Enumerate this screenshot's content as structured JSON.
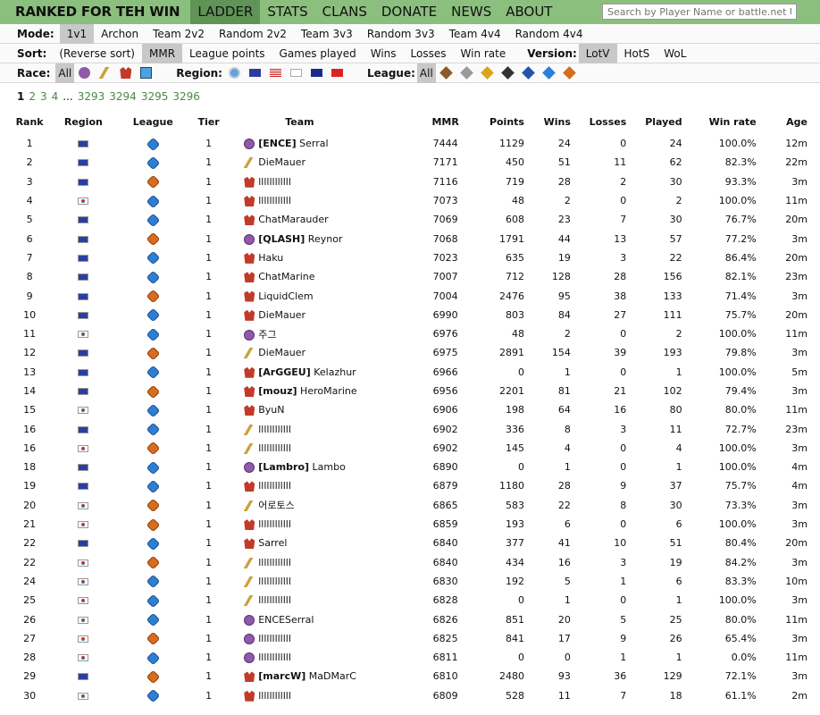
{
  "nav": {
    "brand": "RANKED FOR TEH WIN",
    "links": [
      "LADDER",
      "STATS",
      "CLANS",
      "DONATE",
      "NEWS",
      "ABOUT"
    ],
    "active": "LADDER",
    "search_placeholder": "Search by Player Name or battle.net URL"
  },
  "mode": {
    "label": "Mode:",
    "options": [
      "1v1",
      "Archon",
      "Team 2v2",
      "Random 2v2",
      "Team 3v3",
      "Random 3v3",
      "Team 4v4",
      "Random 4v4"
    ],
    "selected": "1v1"
  },
  "sort": {
    "label": "Sort:",
    "options": [
      "(Reverse sort)",
      "MMR",
      "League points",
      "Games played",
      "Wins",
      "Losses",
      "Win rate"
    ],
    "selected": "MMR",
    "version_label": "Version:",
    "versions": [
      "LotV",
      "HotS",
      "WoL"
    ],
    "version_selected": "LotV"
  },
  "race_filter": {
    "label": "Race:",
    "all": "All",
    "icons": [
      "zerg-icon",
      "protoss-icon",
      "terran-icon",
      "random-icon"
    ]
  },
  "region_filter": {
    "label": "Region:",
    "icons": [
      "globe-icon",
      "eu-flag-icon",
      "us-flag-icon",
      "kr-flag-icon",
      "au-flag-icon",
      "cn-flag-icon"
    ]
  },
  "league_filter": {
    "label": "League:",
    "all": "All",
    "icons": [
      "bronze-icon",
      "silver-icon",
      "gold-icon",
      "platinum-icon",
      "diamond-icon",
      "master-icon",
      "grandmaster-icon"
    ]
  },
  "pager": {
    "pages": [
      "1",
      "2",
      "3",
      "4",
      "...",
      "3293",
      "3294",
      "3295",
      "3296"
    ],
    "current": "1"
  },
  "columns": [
    "Rank",
    "Region",
    "League",
    "Tier",
    "Team",
    "MMR",
    "Points",
    "Wins",
    "Losses",
    "Played",
    "Win rate",
    "Age"
  ],
  "rows": [
    {
      "rank": "1",
      "region": "eu",
      "league": "gm",
      "tier": "1",
      "race": "z",
      "clan": "[ENCE]",
      "name": "Serral",
      "mmr": "7444",
      "points": "1129",
      "wins": "24",
      "losses": "0",
      "played": "24",
      "winrate": "100.0%",
      "age": "12m"
    },
    {
      "rank": "2",
      "region": "eu",
      "league": "gm",
      "tier": "1",
      "race": "p",
      "clan": "",
      "name": "DieMauer",
      "mmr": "7171",
      "points": "450",
      "wins": "51",
      "losses": "11",
      "played": "62",
      "winrate": "82.3%",
      "age": "22m"
    },
    {
      "rank": "3",
      "region": "eu",
      "league": "m",
      "tier": "1",
      "race": "t",
      "clan": "",
      "name": "llllllllllll",
      "mmr": "7116",
      "points": "719",
      "wins": "28",
      "losses": "2",
      "played": "30",
      "winrate": "93.3%",
      "age": "3m"
    },
    {
      "rank": "4",
      "region": "kr",
      "league": "gm",
      "tier": "1",
      "race": "t",
      "clan": "",
      "name": "llllllllllll",
      "mmr": "7073",
      "points": "48",
      "wins": "2",
      "losses": "0",
      "played": "2",
      "winrate": "100.0%",
      "age": "11m"
    },
    {
      "rank": "5",
      "region": "eu",
      "league": "gm",
      "tier": "1",
      "race": "t",
      "clan": "",
      "name": "ChatMarauder",
      "mmr": "7069",
      "points": "608",
      "wins": "23",
      "losses": "7",
      "played": "30",
      "winrate": "76.7%",
      "age": "20m"
    },
    {
      "rank": "6",
      "region": "eu",
      "league": "m",
      "tier": "1",
      "race": "z",
      "clan": "[QLASH]",
      "name": "Reynor",
      "mmr": "7068",
      "points": "1791",
      "wins": "44",
      "losses": "13",
      "played": "57",
      "winrate": "77.2%",
      "age": "3m"
    },
    {
      "rank": "7",
      "region": "eu",
      "league": "gm",
      "tier": "1",
      "race": "t",
      "clan": "",
      "name": "Haku",
      "mmr": "7023",
      "points": "635",
      "wins": "19",
      "losses": "3",
      "played": "22",
      "winrate": "86.4%",
      "age": "20m"
    },
    {
      "rank": "8",
      "region": "eu",
      "league": "gm",
      "tier": "1",
      "race": "t",
      "clan": "",
      "name": "ChatMarine",
      "mmr": "7007",
      "points": "712",
      "wins": "128",
      "losses": "28",
      "played": "156",
      "winrate": "82.1%",
      "age": "23m"
    },
    {
      "rank": "9",
      "region": "eu",
      "league": "m",
      "tier": "1",
      "race": "t",
      "clan": "",
      "name": "LiquidClem",
      "mmr": "7004",
      "points": "2476",
      "wins": "95",
      "losses": "38",
      "played": "133",
      "winrate": "71.4%",
      "age": "3m"
    },
    {
      "rank": "10",
      "region": "eu",
      "league": "gm",
      "tier": "1",
      "race": "t",
      "clan": "",
      "name": "DieMauer",
      "mmr": "6990",
      "points": "803",
      "wins": "84",
      "losses": "27",
      "played": "111",
      "winrate": "75.7%",
      "age": "20m"
    },
    {
      "rank": "11",
      "region": "kr",
      "league": "gm",
      "tier": "1",
      "race": "z",
      "clan": "",
      "name": "주그",
      "mmr": "6976",
      "points": "48",
      "wins": "2",
      "losses": "0",
      "played": "2",
      "winrate": "100.0%",
      "age": "11m"
    },
    {
      "rank": "12",
      "region": "eu",
      "league": "m",
      "tier": "1",
      "race": "p",
      "clan": "",
      "name": "DieMauer",
      "mmr": "6975",
      "points": "2891",
      "wins": "154",
      "losses": "39",
      "played": "193",
      "winrate": "79.8%",
      "age": "3m"
    },
    {
      "rank": "13",
      "region": "eu",
      "league": "gm",
      "tier": "1",
      "race": "t",
      "clan": "[ArGGEU]",
      "name": "Kelazhur",
      "mmr": "6966",
      "points": "0",
      "wins": "1",
      "losses": "0",
      "played": "1",
      "winrate": "100.0%",
      "age": "5m"
    },
    {
      "rank": "14",
      "region": "eu",
      "league": "m",
      "tier": "1",
      "race": "t",
      "clan": "[mouz]",
      "name": "HeroMarine",
      "mmr": "6956",
      "points": "2201",
      "wins": "81",
      "losses": "21",
      "played": "102",
      "winrate": "79.4%",
      "age": "3m"
    },
    {
      "rank": "15",
      "region": "kr",
      "league": "gm",
      "tier": "1",
      "race": "t",
      "clan": "",
      "name": "ByuN",
      "mmr": "6906",
      "points": "198",
      "wins": "64",
      "losses": "16",
      "played": "80",
      "winrate": "80.0%",
      "age": "11m"
    },
    {
      "rank": "16",
      "region": "eu",
      "league": "gm",
      "tier": "1",
      "race": "p",
      "clan": "",
      "name": "llllllllllll",
      "mmr": "6902",
      "points": "336",
      "wins": "8",
      "losses": "3",
      "played": "11",
      "winrate": "72.7%",
      "age": "23m"
    },
    {
      "rank": "16",
      "region": "kr",
      "league": "m",
      "tier": "1",
      "race": "p",
      "clan": "",
      "name": "llllllllllll",
      "mmr": "6902",
      "points": "145",
      "wins": "4",
      "losses": "0",
      "played": "4",
      "winrate": "100.0%",
      "age": "3m"
    },
    {
      "rank": "18",
      "region": "eu",
      "league": "gm",
      "tier": "1",
      "race": "z",
      "clan": "[Lambro]",
      "name": "Lambo",
      "mmr": "6890",
      "points": "0",
      "wins": "1",
      "losses": "0",
      "played": "1",
      "winrate": "100.0%",
      "age": "4m"
    },
    {
      "rank": "19",
      "region": "eu",
      "league": "gm",
      "tier": "1",
      "race": "t",
      "clan": "",
      "name": "llllllllllll",
      "mmr": "6879",
      "points": "1180",
      "wins": "28",
      "losses": "9",
      "played": "37",
      "winrate": "75.7%",
      "age": "4m"
    },
    {
      "rank": "20",
      "region": "kr",
      "league": "m",
      "tier": "1",
      "race": "p",
      "clan": "",
      "name": "어로토스",
      "mmr": "6865",
      "points": "583",
      "wins": "22",
      "losses": "8",
      "played": "30",
      "winrate": "73.3%",
      "age": "3m"
    },
    {
      "rank": "21",
      "region": "kr",
      "league": "m",
      "tier": "1",
      "race": "t",
      "clan": "",
      "name": "llllllllllll",
      "mmr": "6859",
      "points": "193",
      "wins": "6",
      "losses": "0",
      "played": "6",
      "winrate": "100.0%",
      "age": "3m"
    },
    {
      "rank": "22",
      "region": "eu",
      "league": "gm",
      "tier": "1",
      "race": "t",
      "clan": "",
      "name": "Sarrel",
      "mmr": "6840",
      "points": "377",
      "wins": "41",
      "losses": "10",
      "played": "51",
      "winrate": "80.4%",
      "age": "20m"
    },
    {
      "rank": "22",
      "region": "kr",
      "league": "m",
      "tier": "1",
      "race": "p",
      "clan": "",
      "name": "llllllllllll",
      "mmr": "6840",
      "points": "434",
      "wins": "16",
      "losses": "3",
      "played": "19",
      "winrate": "84.2%",
      "age": "3m"
    },
    {
      "rank": "24",
      "region": "kr",
      "league": "gm",
      "tier": "1",
      "race": "p",
      "clan": "",
      "name": "llllllllllll",
      "mmr": "6830",
      "points": "192",
      "wins": "5",
      "losses": "1",
      "played": "6",
      "winrate": "83.3%",
      "age": "10m"
    },
    {
      "rank": "25",
      "region": "kr",
      "league": "gm",
      "tier": "1",
      "race": "p",
      "clan": "",
      "name": "llllllllllll",
      "mmr": "6828",
      "points": "0",
      "wins": "1",
      "losses": "0",
      "played": "1",
      "winrate": "100.0%",
      "age": "3m"
    },
    {
      "rank": "26",
      "region": "kr",
      "league": "gm",
      "tier": "1",
      "race": "z",
      "clan": "",
      "name": "ENCESerral",
      "mmr": "6826",
      "points": "851",
      "wins": "20",
      "losses": "5",
      "played": "25",
      "winrate": "80.0%",
      "age": "11m"
    },
    {
      "rank": "27",
      "region": "kr",
      "league": "m",
      "tier": "1",
      "race": "z",
      "clan": "",
      "name": "llllllllllll",
      "mmr": "6825",
      "points": "841",
      "wins": "17",
      "losses": "9",
      "played": "26",
      "winrate": "65.4%",
      "age": "3m"
    },
    {
      "rank": "28",
      "region": "kr",
      "league": "gm",
      "tier": "1",
      "race": "z",
      "clan": "",
      "name": "llllllllllll",
      "mmr": "6811",
      "points": "0",
      "wins": "0",
      "losses": "1",
      "played": "1",
      "winrate": "0.0%",
      "age": "11m"
    },
    {
      "rank": "29",
      "region": "eu",
      "league": "m",
      "tier": "1",
      "race": "t",
      "clan": "[marcW]",
      "name": "MaDMarC",
      "mmr": "6810",
      "points": "2480",
      "wins": "93",
      "losses": "36",
      "played": "129",
      "winrate": "72.1%",
      "age": "3m"
    },
    {
      "rank": "30",
      "region": "kr",
      "league": "gm",
      "tier": "1",
      "race": "t",
      "clan": "",
      "name": "llllllllllll",
      "mmr": "6809",
      "points": "528",
      "wins": "11",
      "losses": "7",
      "played": "18",
      "winrate": "61.1%",
      "age": "2m"
    }
  ]
}
